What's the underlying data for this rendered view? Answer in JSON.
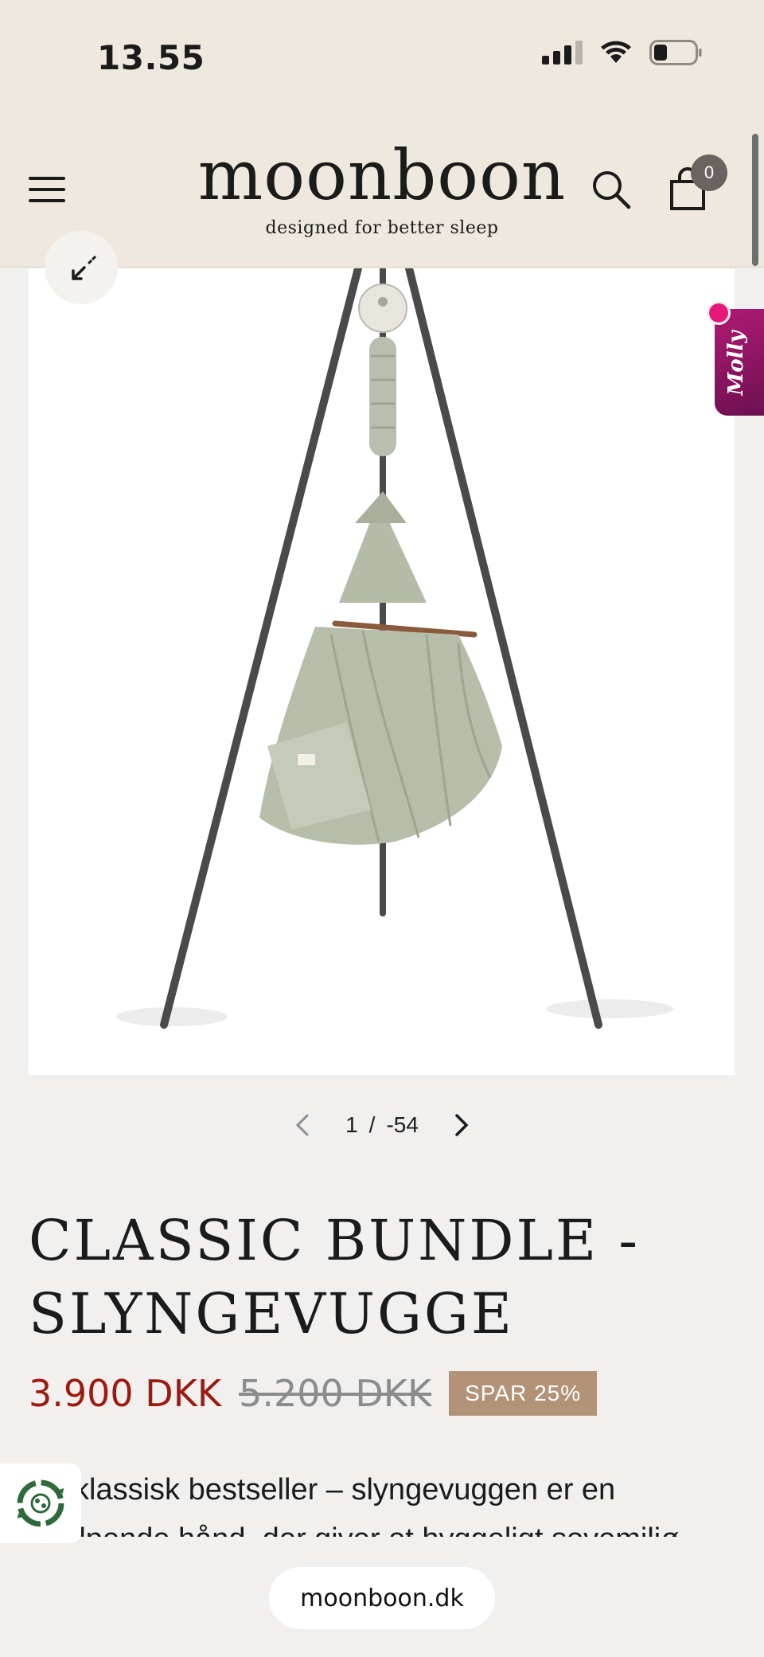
{
  "status_bar": {
    "time": "13.55"
  },
  "header": {
    "logo_word": "moonboon",
    "logo_tagline": "designed for better sleep",
    "cart_count": "0"
  },
  "molly_badge": {
    "label": "Molly"
  },
  "gallery": {
    "current": "1",
    "separator": "/",
    "total": "-54"
  },
  "product": {
    "title_line1": "CLASSIC BUNDLE -",
    "title_line2": "SLYNGEVUGGE",
    "price_now": "3.900 DKK",
    "price_old": "5.200 DKK",
    "save_badge": "SPAR 25%",
    "description": "En klassisk bestseller – slyngevuggen er en hjælpende hånd, der giver et hyggeligt sovemiljø"
  },
  "browser": {
    "url": "moonboon.dk"
  },
  "colors": {
    "header_bg": "#efe8df",
    "page_bg": "#f2f0ee",
    "price_red": "#9b1b13",
    "save_badge_bg": "#b39377",
    "molly_magenta": "#b01a74"
  }
}
